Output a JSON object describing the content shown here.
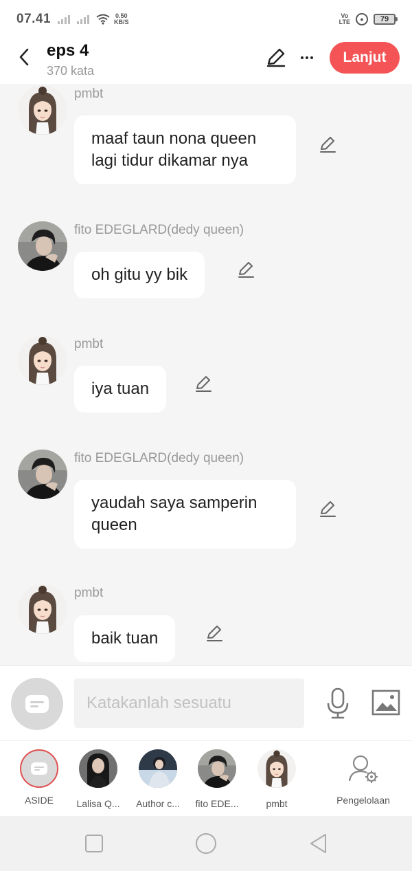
{
  "status_bar": {
    "time": "07.41",
    "net_speed": "0.50",
    "net_unit": "KB/S",
    "volte_top": "Vo",
    "volte_bottom": "LTE",
    "battery": "79"
  },
  "header": {
    "title": "eps 4",
    "subtitle": "370 kata",
    "continue_label": "Lanjut"
  },
  "messages": [
    {
      "sender": "pmbt",
      "text_lines": [
        "maaf taun nona queen",
        "lagi tidur dikamar nya"
      ],
      "avatar": "girl"
    },
    {
      "sender": "fito EDEGLARD(dedy queen)",
      "text_lines": [
        "oh gitu yy bik"
      ],
      "avatar": "boy"
    },
    {
      "sender": "pmbt",
      "text_lines": [
        "iya tuan"
      ],
      "avatar": "girl"
    },
    {
      "sender": "fito EDEGLARD(dedy queen)",
      "text_lines": [
        "yaudah saya samperin",
        "queen"
      ],
      "avatar": "boy"
    },
    {
      "sender": "pmbt",
      "text_lines": [
        "baik tuan"
      ],
      "avatar": "girl"
    }
  ],
  "input": {
    "placeholder": "Katakanlah sesuatu"
  },
  "characters": [
    {
      "label": "ASIDE"
    },
    {
      "label": "Lalisa Q..."
    },
    {
      "label": "Author c..."
    },
    {
      "label": "fito EDE..."
    },
    {
      "label": "pmbt"
    }
  ],
  "manage_label": "Pengelolaan",
  "colors": {
    "accent": "#f45456",
    "background": "#f5f5f5",
    "bubble": "#ffffff",
    "muted_text": "#999999"
  },
  "icons": [
    "back-icon",
    "edit-icon",
    "more-icon",
    "mic-icon",
    "image-icon",
    "manage-user-icon",
    "nav-square-icon",
    "nav-circle-icon",
    "nav-back-triangle-icon"
  ]
}
